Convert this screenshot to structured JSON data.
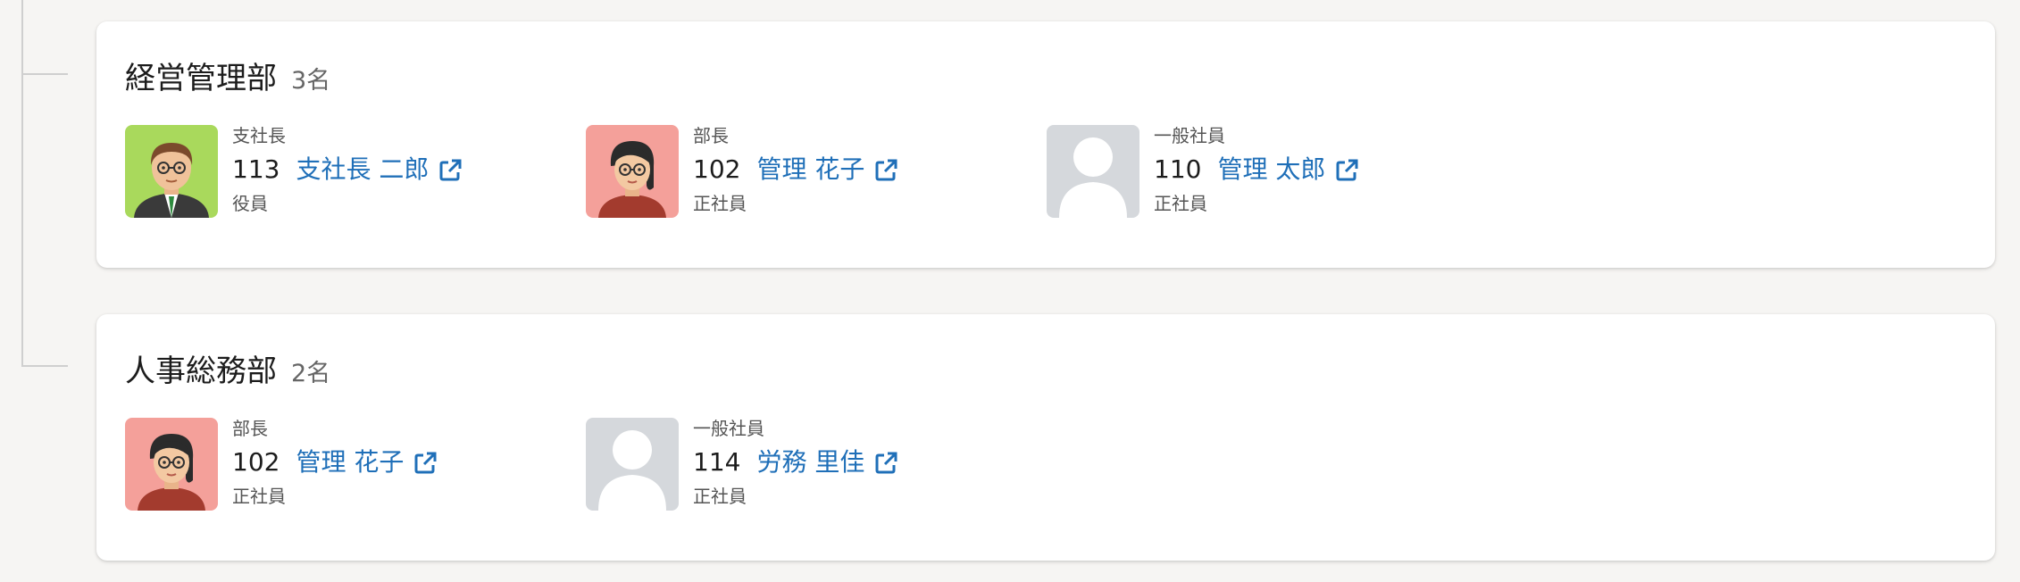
{
  "departments": [
    {
      "name": "経営管理部",
      "count": "3名",
      "members": [
        {
          "title": "支社長",
          "id": "113",
          "name": "支社長 二郎",
          "type": "役員",
          "avatar": "man-avatar"
        },
        {
          "title": "部長",
          "id": "102",
          "name": "管理 花子",
          "type": "正社員",
          "avatar": "woman-avatar"
        },
        {
          "title": "一般社員",
          "id": "110",
          "name": "管理 太郎",
          "type": "正社員",
          "avatar": "placeholder-avatar"
        }
      ]
    },
    {
      "name": "人事総務部",
      "count": "2名",
      "members": [
        {
          "title": "部長",
          "id": "102",
          "name": "管理 花子",
          "type": "正社員",
          "avatar": "woman-avatar"
        },
        {
          "title": "一般社員",
          "id": "114",
          "name": "労務 里佳",
          "type": "正社員",
          "avatar": "placeholder-avatar"
        }
      ]
    }
  ],
  "colors": {
    "link": "#1f6fb8",
    "card_bg": "#ffffff",
    "page_bg": "#f6f5f3"
  },
  "icons": {
    "external_link": "external-link-icon"
  }
}
